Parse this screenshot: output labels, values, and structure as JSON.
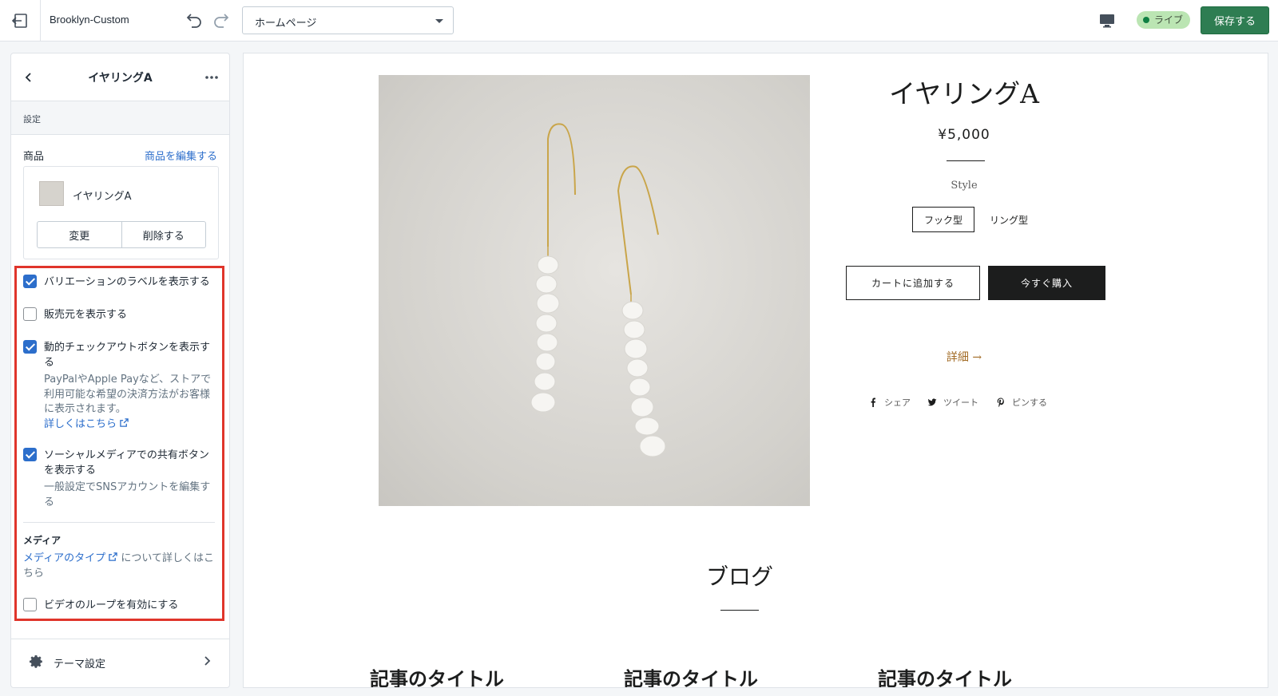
{
  "topbar": {
    "theme_name": "Brooklyn-Custom",
    "page_select_value": "ホームページ",
    "live_label": "ライブ",
    "save_label": "保存する"
  },
  "sidebar": {
    "title": "イヤリングA",
    "section_label": "設定",
    "product": {
      "label": "商品",
      "edit_link": "商品を編集する",
      "name": "イヤリングA",
      "change_label": "変更",
      "delete_label": "削除する"
    },
    "options": [
      {
        "label": "バリエーションのラベルを表示する",
        "checked": true
      },
      {
        "label": "販売元を表示する",
        "checked": false
      },
      {
        "label": "動的チェックアウトボタンを表示する",
        "checked": true,
        "help": "PayPalやApple Payなど、ストアで利用可能な希望の決済方法がお客様に表示されます。",
        "help_link": "詳しくはこちら"
      },
      {
        "label": "ソーシャルメディアでの共有ボタンを表示する",
        "checked": true,
        "help": "一般設定でSNSアカウントを編集する"
      },
      {
        "label": "ビデオのループを有効にする",
        "checked": false
      }
    ],
    "media": {
      "title": "メディア",
      "link": "メディアのタイプ",
      "text": "について詳しくはこちら"
    },
    "theme_settings_label": "テーマ設定"
  },
  "preview": {
    "product_title": "イヤリングA",
    "price": "¥5,000",
    "style_label": "Style",
    "variants": [
      "フック型",
      "リング型"
    ],
    "add_to_cart": "カートに追加する",
    "buy_now": "今すぐ購入",
    "details_link": "詳細 →",
    "share": [
      "シェア",
      "ツイート",
      "ピンする"
    ],
    "blog_title": "ブログ",
    "articles": [
      "記事のタイトル",
      "記事のタイトル",
      "記事のタイトル"
    ]
  },
  "colors": {
    "accent": "#2c6ecb",
    "save": "#2e7d52",
    "highlight": "#e0352b",
    "details": "#a26b25"
  }
}
